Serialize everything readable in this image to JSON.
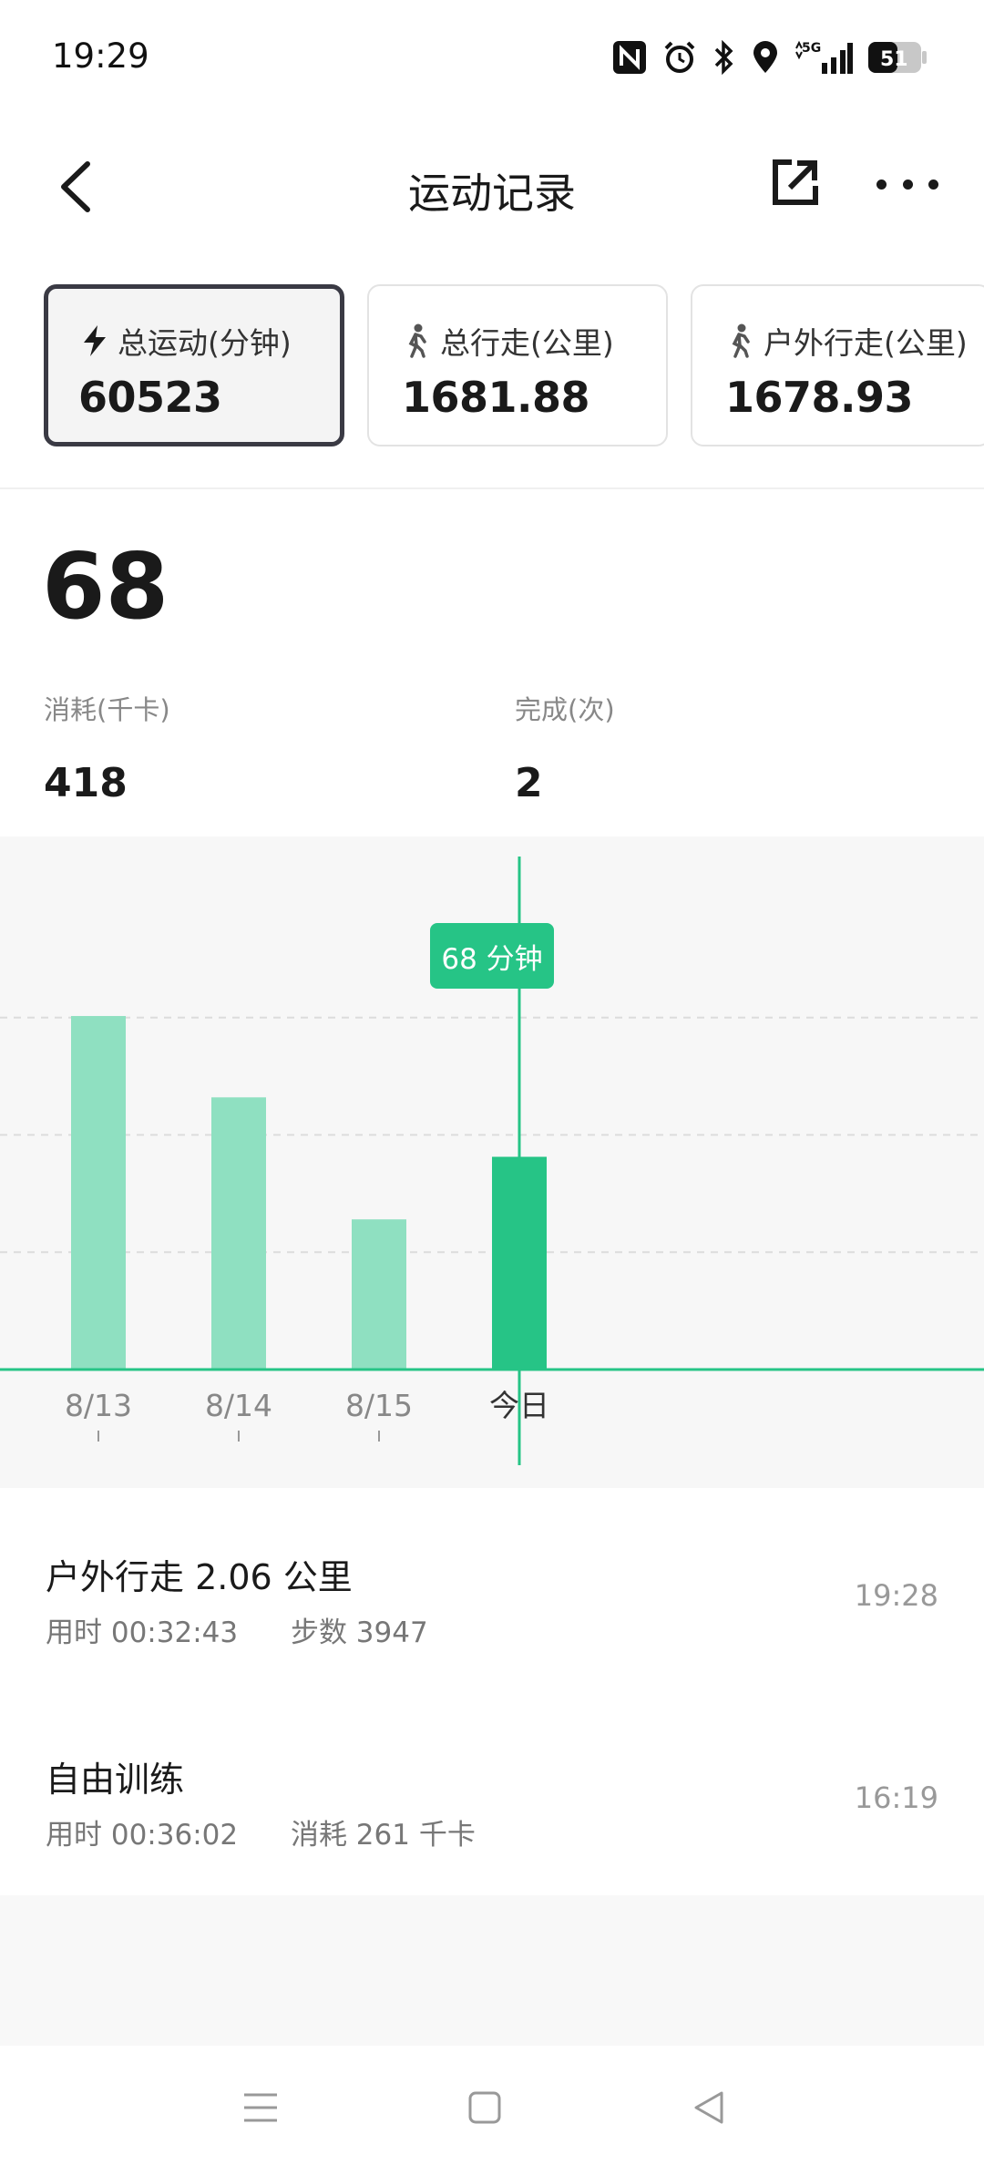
{
  "status_bar": {
    "time": "19:29",
    "icons": [
      "nfc-icon",
      "alarm-icon",
      "bluetooth-icon",
      "location-icon",
      "signal-5g-icon",
      "battery-icon"
    ],
    "network": "5G",
    "battery": "51"
  },
  "header": {
    "title": "运动记录",
    "icons": [
      "back-icon",
      "share-icon",
      "more-icon"
    ]
  },
  "summary_cards": [
    {
      "label": "总运动(分钟)",
      "value": "60523",
      "icon": "lightning-icon",
      "selected": true
    },
    {
      "label": "总行走(公里)",
      "value": "1681.88",
      "icon": "walk-icon",
      "selected": false
    },
    {
      "label": "户外行走(公里)",
      "value": "1678.93",
      "icon": "walk-icon",
      "selected": false
    }
  ],
  "main_metric": {
    "value": "68"
  },
  "stats": [
    {
      "label": "消耗(千卡)",
      "value": "418"
    },
    {
      "label": "完成(次)",
      "value": "2"
    }
  ],
  "chart_data": {
    "type": "bar",
    "categories": [
      "8/13",
      "8/14",
      "8/15",
      "今日"
    ],
    "values": [
      113,
      87,
      48,
      68
    ],
    "unit": "分钟",
    "ylim": [
      0,
      150
    ],
    "gridlines": [
      37.5,
      75,
      112.5
    ],
    "selected_index": 3,
    "tooltip": "68 分钟",
    "colors": {
      "bar": "#8fe0c1",
      "selected_bar": "#26c486",
      "line": "#26c486",
      "grid": "#dcdcdc"
    }
  },
  "records": [
    {
      "title": "户外行走 2.06 公里",
      "detail1": "用时 00:32:43",
      "detail2": "步数 3947",
      "time": "19:28"
    },
    {
      "title": "自由训练",
      "detail1": "用时 00:36:02",
      "detail2": "消耗 261 千卡",
      "time": "16:19"
    }
  ],
  "nav_bar": {
    "icons": [
      "menu-icon",
      "home-icon",
      "back-triangle-icon"
    ]
  }
}
